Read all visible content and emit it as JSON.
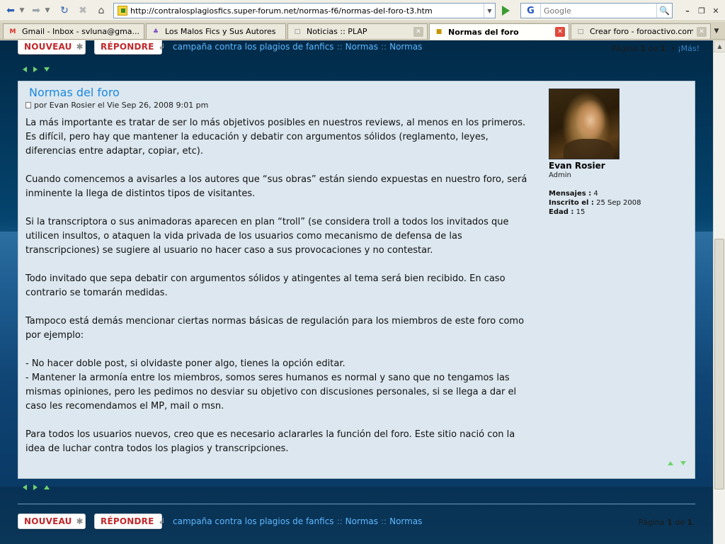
{
  "browser": {
    "url": "http://contralosplagiosfics.super-forum.net/normas-f6/normas-del-foro-t3.htm",
    "search_placeholder": "Google",
    "search_engine_letter": "G",
    "tabs": [
      {
        "label": "Gmail - Inbox - svluna@gma...",
        "icon": "gmail-icon",
        "active": false
      },
      {
        "label": "Los Malos Fics y Sus Autores",
        "icon": "forum-icon",
        "active": false
      },
      {
        "label": "Noticias :: PLAP",
        "icon": "page-icon",
        "active": false
      },
      {
        "label": "Normas del foro",
        "icon": "forumactif-icon",
        "active": true
      },
      {
        "label": "Crear foro - foroactivo.com",
        "icon": "page-icon",
        "active": false
      }
    ]
  },
  "toolbar": {
    "new_label": "NOUVEAU",
    "reply_label": "RÉPONDRE"
  },
  "breadcrumb": {
    "items": [
      "campaña contra los plagios de fanfics",
      "Normas",
      "Normas"
    ],
    "separator": "::"
  },
  "pagination_top": {
    "prefix": "Página",
    "current": "1",
    "of": "de",
    "total": "1",
    "tail": ".",
    "bullet": "•",
    "more": "¡Más!"
  },
  "pagination_bottom": {
    "prefix": "Página",
    "current": "1",
    "of": "de",
    "total": "1",
    "tail": "."
  },
  "post": {
    "title": "Normas del foro",
    "meta": "por Evan Rosier el Vie Sep 26, 2008 9:01 pm",
    "paragraphs": [
      "La más importante es tratar de ser lo más objetivos posibles en nuestros reviews, al menos en los primeros. Es difícil, pero hay que mantener la educación y debatir con argumentos sólidos (reglamento, leyes, diferencias entre adaptar, copiar, etc).",
      "Cuando comencemos a avisarles a los autores que “sus obras” están siendo expuestas en nuestro foro, será inminente la llega de distintos tipos de visitantes.",
      "Si la transcriptora o sus animadoras aparecen en plan “troll” (se considera troll a todos los invitados que utilicen insultos, o ataquen la vida privada de los usuarios como mecanismo de defensa de las transcripciones) se sugiere al usuario no hacer caso a sus provocaciones y no contestar.",
      "Todo invitado que sepa debatir con argumentos sólidos y atingentes al tema será bien recibido. En caso contrario se tomarán medidas.",
      "Tampoco está demás mencionar ciertas normas básicas de regulación para los miembros de este foro como por ejemplo:"
    ],
    "rules": [
      "- No hacer doble post, si olvidaste poner algo, tienes la opción editar.",
      "- Mantener la armonía entre los miembros, somos seres humanos es normal y sano que no tengamos las mismas opiniones, pero les pedimos no desviar su objetivo con discusiones personales, si se llega a dar el caso les recomendamos el MP, mail o msn."
    ],
    "closing": "Para todos los usuarios nuevos, creo que es necesario aclararles la función del foro. Este sitio nació con la idea de luchar contra todos los plagios y transcripciones."
  },
  "author": {
    "name": "Evan Rosier",
    "role": "Admin",
    "stats": [
      {
        "label": "Mensajes :",
        "value": "4"
      },
      {
        "label": "Inscrito el :",
        "value": "25 Sep 2008"
      },
      {
        "label": "Edad :",
        "value": "15"
      }
    ]
  },
  "colors": {
    "accent_link": "#5fb8ff",
    "post_title": "#1a88e0",
    "button_text": "#c0282b",
    "post_bg": "#dce7ef",
    "nav_arrows": "#6fd36f"
  }
}
